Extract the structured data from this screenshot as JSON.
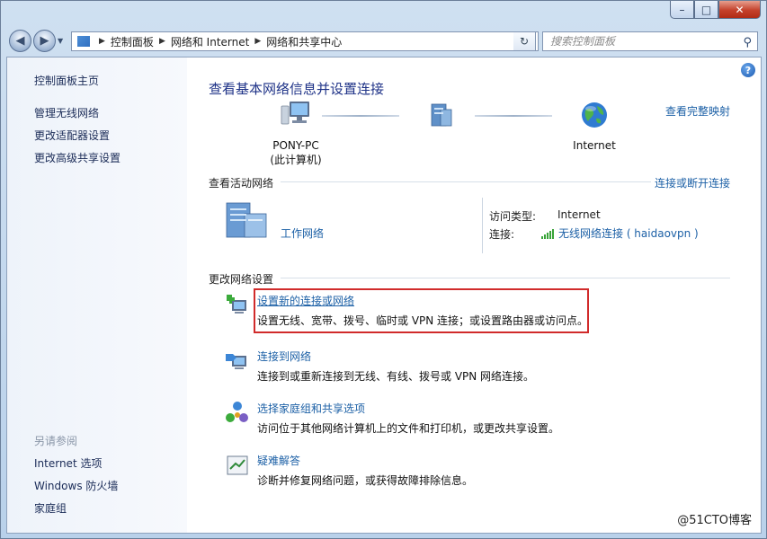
{
  "window": {
    "caption_buttons": {
      "min": "–",
      "max": "□",
      "close": "✕"
    }
  },
  "nav": {
    "back": "◀",
    "forward": "▶",
    "breadcrumbs": [
      "控制面板",
      "网络和 Internet",
      "网络和共享中心"
    ],
    "search_placeholder": "搜索控制面板"
  },
  "sidebar": {
    "home": "控制面板主页",
    "items": [
      "管理无线网络",
      "更改适配器设置",
      "更改高级共享设置"
    ],
    "see_also_title": "另请参阅",
    "see_also": [
      "Internet 选项",
      "Windows 防火墙",
      "家庭组"
    ]
  },
  "main": {
    "heading": "查看基本网络信息并设置连接",
    "view_full_map": "查看完整映射",
    "map": {
      "pc_name": "PONY-PC",
      "pc_sub": "(此计算机)",
      "internet": "Internet"
    },
    "active_label": "查看活动网络",
    "connect_disconnect": "连接或断开连接",
    "network_name": "工作网络",
    "access_type_label": "访问类型:",
    "access_type_value": "Internet",
    "connection_label": "连接:",
    "connection_value": "无线网络连接 ( haidaovpn )",
    "change_label": "更改网络设置",
    "tasks": [
      {
        "title": "设置新的连接或网络",
        "desc": "设置无线、宽带、拨号、临时或 VPN 连接；或设置路由器或访问点。"
      },
      {
        "title": "连接到网络",
        "desc": "连接到或重新连接到无线、有线、拨号或 VPN 网络连接。"
      },
      {
        "title": "选择家庭组和共享选项",
        "desc": "访问位于其他网络计算机上的文件和打印机，或更改共享设置。"
      },
      {
        "title": "疑难解答",
        "desc": "诊断并修复网络问题，或获得故障排除信息。"
      }
    ]
  },
  "watermark": "@51CTO博客",
  "colors": {
    "link": "#1c60a6",
    "heading": "#1e3287",
    "highlight": "#d12b2b"
  }
}
